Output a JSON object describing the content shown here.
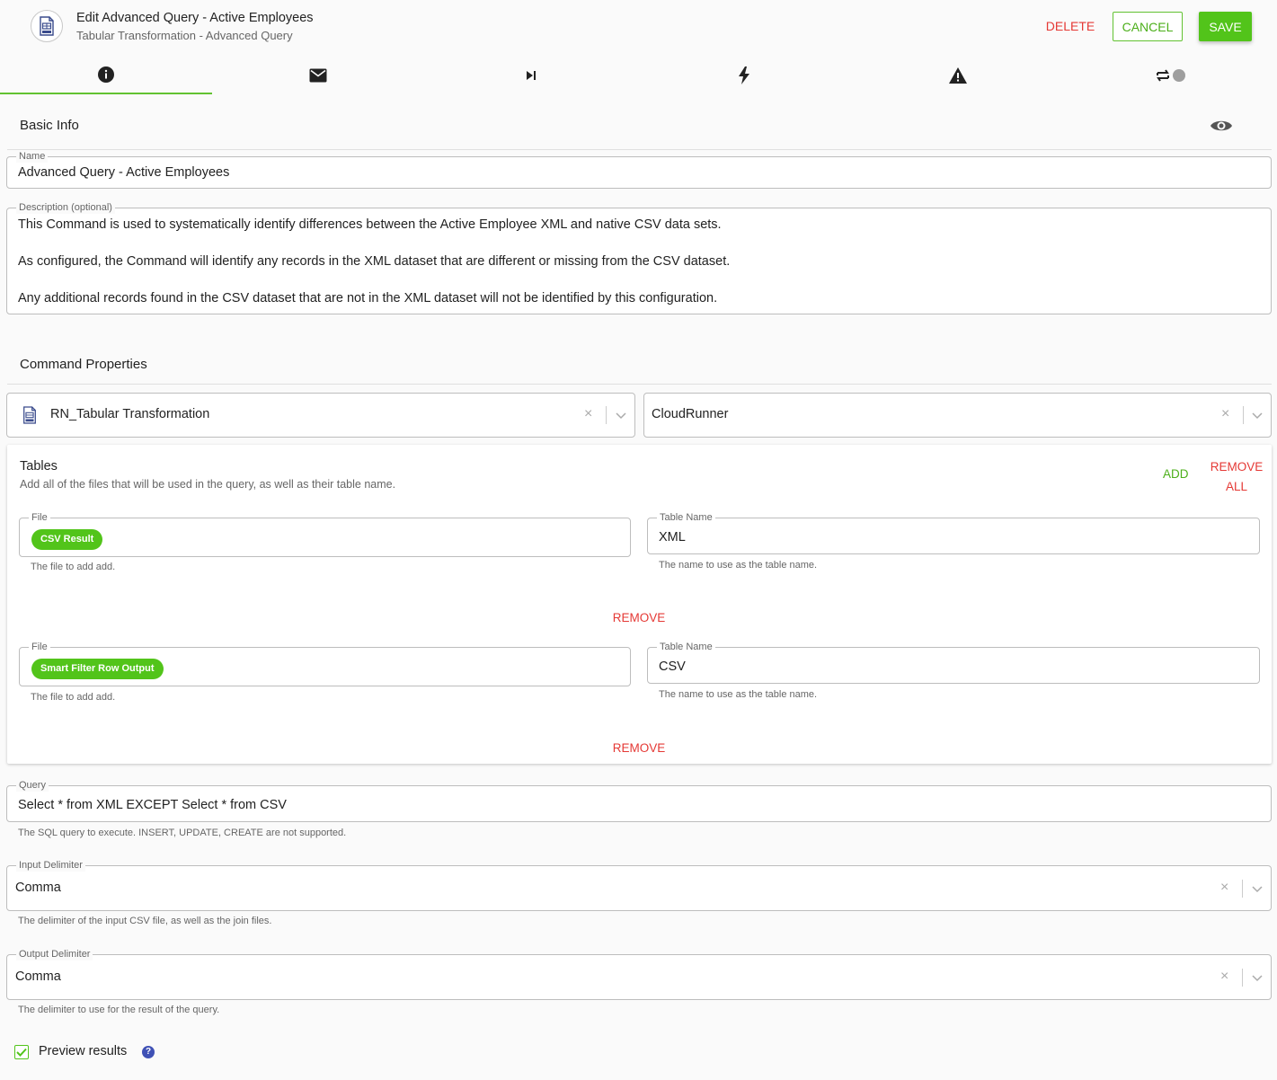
{
  "header": {
    "title": "Edit Advanced Query - Active Employees",
    "subtitle": "Tabular Transformation - Advanced Query",
    "delete_label": "DELETE",
    "cancel_label": "CANCEL",
    "save_label": "SAVE"
  },
  "tabs": [
    {
      "icon": "info-icon",
      "active": true
    },
    {
      "icon": "mail-icon",
      "active": false
    },
    {
      "icon": "skip-next-icon",
      "active": false
    },
    {
      "icon": "lightning-icon",
      "active": false
    },
    {
      "icon": "warning-icon",
      "active": false
    },
    {
      "icon": "repeat-toggle-icon",
      "active": false
    }
  ],
  "basic_info": {
    "section_title": "Basic Info",
    "name_label": "Name",
    "name_value": "Advanced Query - Active Employees",
    "description_label": "Description (optional)",
    "description_lines": [
      "This Command is used to systematically identify differences between the Active Employee XML and native CSV data sets.",
      "As configured, the Command will identify any records in the XML dataset that are different or missing from the CSV dataset.",
      "Any additional records found in the CSV dataset that are not in the XML dataset will not be identified by this configuration."
    ]
  },
  "command_properties": {
    "section_title": "Command Properties",
    "command_select": "RN_Tabular Transformation",
    "runner_select": "CloudRunner"
  },
  "tables": {
    "title": "Tables",
    "subtitle": "Add all of the files that will be used in the query, as well as their table name.",
    "add_label": "ADD",
    "remove_all_line1": "REMOVE",
    "remove_all_line2": "ALL",
    "rows": [
      {
        "file_label": "File",
        "file_chip": "CSV Result",
        "file_helper": "The file to add add.",
        "table_label": "Table Name",
        "table_value": "XML",
        "table_helper": "The name to use as the table name.",
        "remove_label": "REMOVE"
      },
      {
        "file_label": "File",
        "file_chip": "Smart Filter Row Output",
        "file_helper": "The file to add add.",
        "table_label": "Table Name",
        "table_value": "CSV",
        "table_helper": "The name to use as the table name.",
        "remove_label": "REMOVE"
      }
    ]
  },
  "query": {
    "label": "Query",
    "value": "Select * from XML EXCEPT Select * from CSV",
    "helper": "The SQL query to execute. INSERT, UPDATE, CREATE are not supported."
  },
  "input_delimiter": {
    "label": "Input Delimiter",
    "value": "Comma",
    "helper": "The delimiter of the input CSV file, as well as the join files."
  },
  "output_delimiter": {
    "label": "Output Delimiter",
    "value": "Comma",
    "helper": "The delimiter to use for the result of the query."
  },
  "preview": {
    "label": "Preview results",
    "checked": true,
    "help": "?"
  },
  "colors": {
    "accent_green": "#52c41a",
    "danger_red": "#e53935",
    "help_blue": "#3f51b5"
  }
}
